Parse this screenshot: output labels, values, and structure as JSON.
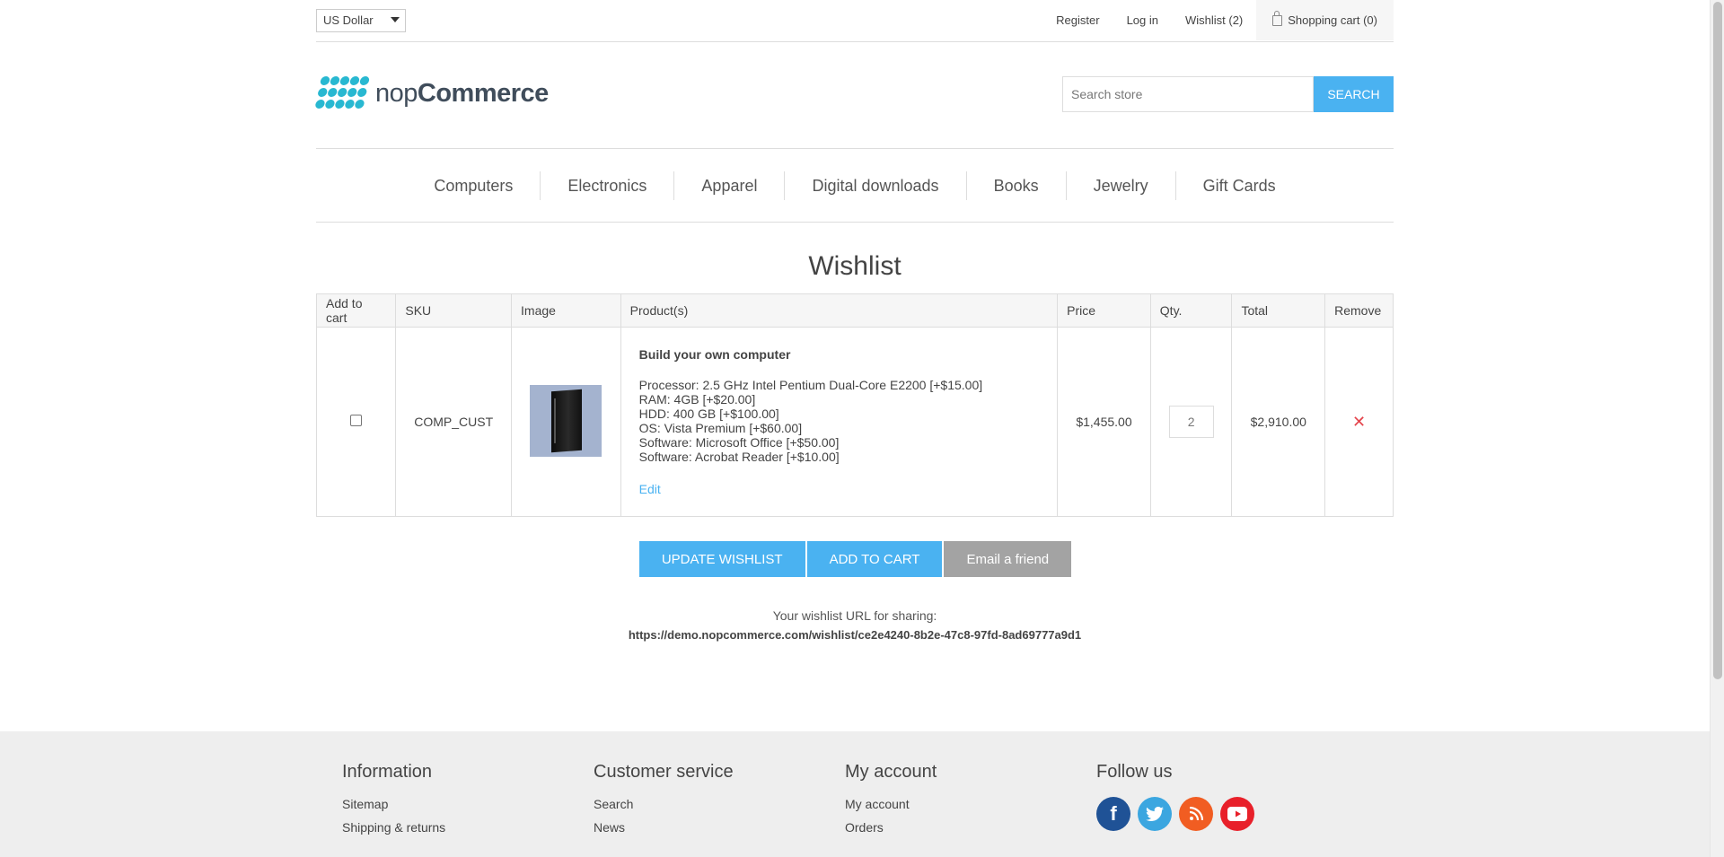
{
  "header": {
    "currency": "US Dollar",
    "links": {
      "register": "Register",
      "login": "Log in",
      "wishlist": "Wishlist (2)",
      "cart": "Shopping cart (0)"
    },
    "logo": {
      "part1": "nop",
      "part2": "Commerce"
    },
    "search": {
      "placeholder": "Search store",
      "button": "SEARCH"
    }
  },
  "menu": [
    "Computers",
    "Electronics",
    "Apparel",
    "Digital downloads",
    "Books",
    "Jewelry",
    "Gift Cards"
  ],
  "page_title": "Wishlist",
  "table": {
    "headers": [
      "Add to cart",
      "SKU",
      "Image",
      "Product(s)",
      "Price",
      "Qty.",
      "Total",
      "Remove"
    ],
    "row": {
      "sku": "COMP_CUST",
      "product_name": "Build your own computer",
      "attributes": [
        "Processor: 2.5 GHz Intel Pentium Dual-Core E2200 [+$15.00]",
        "RAM: 4GB [+$20.00]",
        "HDD: 400 GB [+$100.00]",
        "OS: Vista Premium [+$60.00]",
        "Software: Microsoft Office [+$50.00]",
        "Software: Acrobat Reader [+$10.00]"
      ],
      "edit": "Edit",
      "price": "$1,455.00",
      "qty": "2",
      "total": "$2,910.00",
      "remove": "✕"
    }
  },
  "buttons": {
    "update": "UPDATE WISHLIST",
    "add_to_cart": "ADD TO CART",
    "email": "Email a friend"
  },
  "share": {
    "label": "Your wishlist URL for sharing:",
    "url": "https://demo.nopcommerce.com/wishlist/ce2e4240-8b2e-47c8-97fd-8ad69777a9d1"
  },
  "footer": {
    "information": {
      "title": "Information",
      "links": [
        "Sitemap",
        "Shipping & returns"
      ]
    },
    "customer_service": {
      "title": "Customer service",
      "links": [
        "Search",
        "News"
      ]
    },
    "my_account": {
      "title": "My account",
      "links": [
        "My account",
        "Orders"
      ]
    },
    "follow_us": {
      "title": "Follow us",
      "icons": [
        "facebook-icon",
        "twitter-icon",
        "rss-icon",
        "youtube-icon"
      ]
    }
  },
  "colors": {
    "accent": "#4ab2f1",
    "remove": "#e4434b",
    "footer_bg": "#eeeeee",
    "gray_button": "#a3a3a3"
  }
}
